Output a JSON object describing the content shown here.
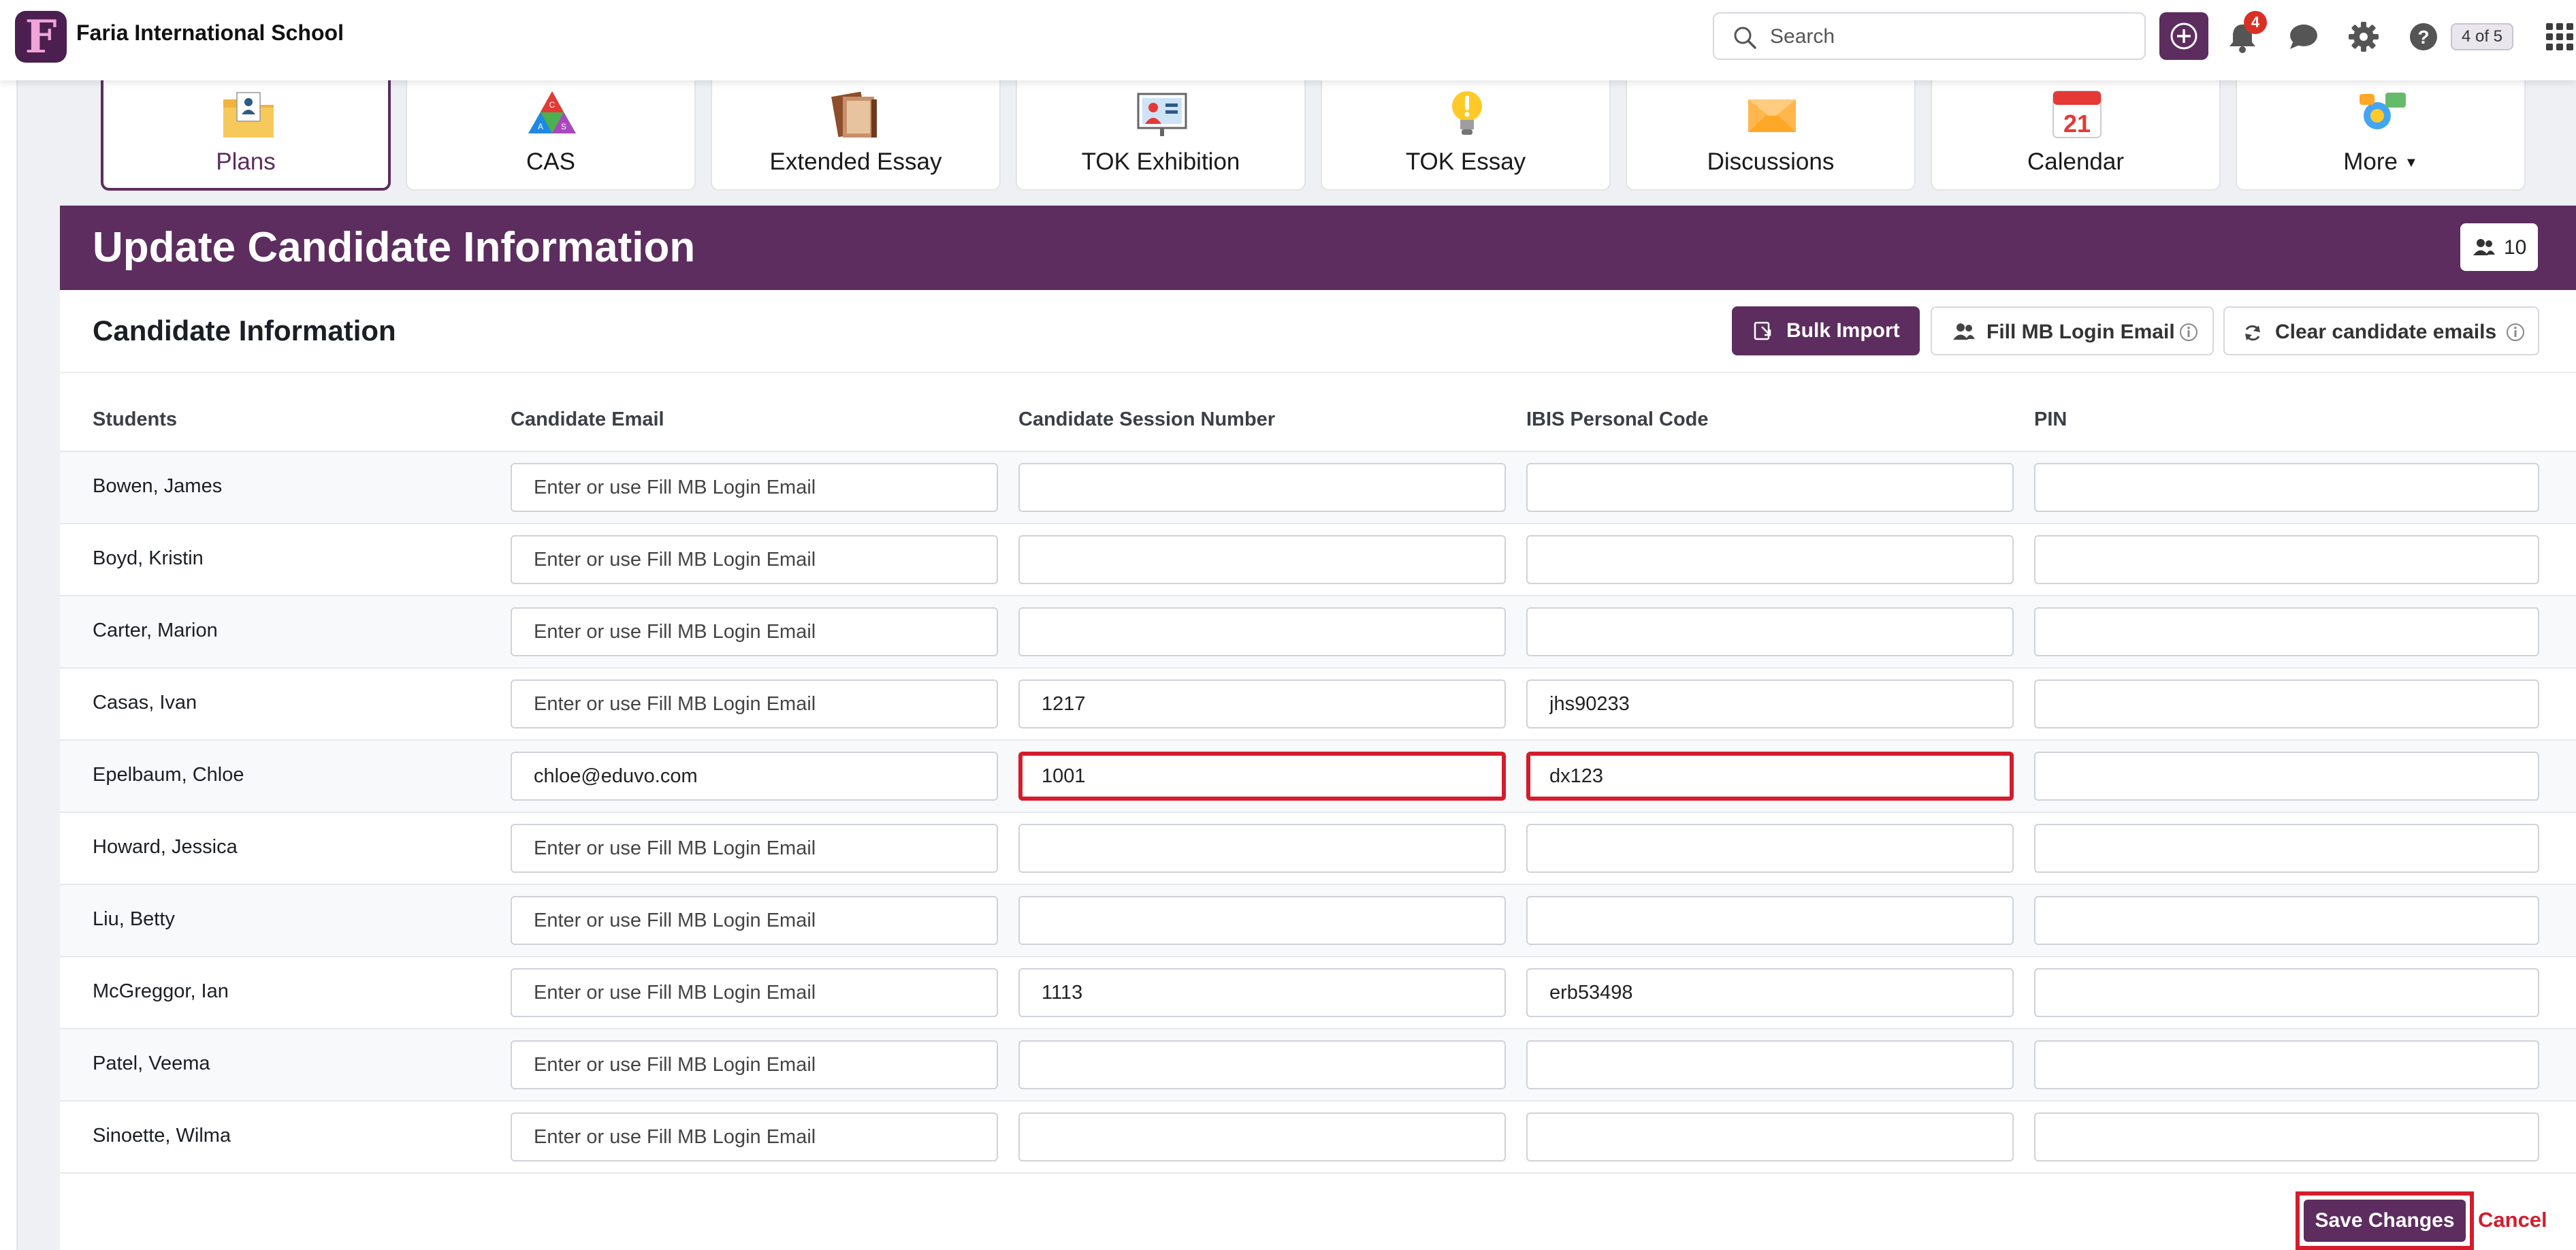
{
  "app": {
    "school_name": "Faria International School",
    "logo_letter": "F"
  },
  "header": {
    "search_placeholder": "Search",
    "notification_count": "4",
    "page_counter": "4 of 5"
  },
  "tiles": [
    {
      "label": "Plans",
      "icon": "plans-icon",
      "active": true
    },
    {
      "label": "CAS",
      "icon": "cas-icon"
    },
    {
      "label": "Extended Essay",
      "icon": "extended-essay-icon"
    },
    {
      "label": "TOK Exhibition",
      "icon": "tok-exhibition-icon"
    },
    {
      "label": "TOK Essay",
      "icon": "tok-essay-icon"
    },
    {
      "label": "Discussions",
      "icon": "discussions-icon"
    },
    {
      "label": "Calendar",
      "icon": "calendar-icon",
      "day": "21"
    },
    {
      "label": "More",
      "icon": "more-icon"
    }
  ],
  "panel": {
    "title": "Update Candidate Information",
    "member_count": "10",
    "section_title": "Candidate Information",
    "buttons": {
      "bulk_import": "Bulk Import",
      "fill_mb": "Fill MB Login Email",
      "clear_emails": "Clear candidate emails"
    }
  },
  "table": {
    "headers": [
      "Students",
      "Candidate Email",
      "Candidate Session Number",
      "IBIS Personal Code",
      "PIN"
    ],
    "email_placeholder": "Enter or use Fill MB Login Email",
    "rows": [
      {
        "name": "Bowen, James",
        "email": "",
        "session": "",
        "ibis": "",
        "pin": ""
      },
      {
        "name": "Boyd, Kristin",
        "email": "",
        "session": "",
        "ibis": "",
        "pin": ""
      },
      {
        "name": "Carter, Marion",
        "email": "",
        "session": "",
        "ibis": "",
        "pin": ""
      },
      {
        "name": "Casas, Ivan",
        "email": "",
        "session": "1217",
        "ibis": "jhs90233",
        "pin": ""
      },
      {
        "name": "Epelbaum, Chloe",
        "email": "chloe@eduvo.com",
        "session": "1001",
        "ibis": "dx123",
        "pin": ""
      },
      {
        "name": "Howard, Jessica",
        "email": "",
        "session": "",
        "ibis": "",
        "pin": ""
      },
      {
        "name": "Liu, Betty",
        "email": "",
        "session": "",
        "ibis": "",
        "pin": ""
      },
      {
        "name": "McGreggor, Ian",
        "email": "",
        "session": "1113",
        "ibis": "erb53498",
        "pin": ""
      },
      {
        "name": "Patel, Veema",
        "email": "",
        "session": "",
        "ibis": "",
        "pin": ""
      },
      {
        "name": "Sinoette, Wilma",
        "email": "",
        "session": "",
        "ibis": "",
        "pin": ""
      }
    ]
  },
  "footer": {
    "save_label": "Save Changes",
    "cancel_label": "Cancel"
  },
  "colors": {
    "brand": "#5c2d5e",
    "highlight": "#d41c2c",
    "badge": "#d93025"
  }
}
